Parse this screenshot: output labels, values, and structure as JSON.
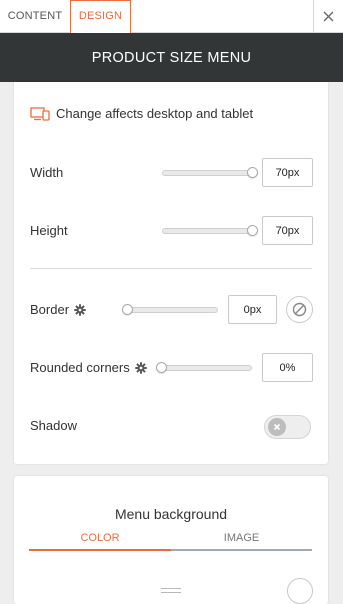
{
  "tabs": {
    "content": "CONTENT",
    "design": "DESIGN"
  },
  "title": "PRODUCT SIZE MENU",
  "device_note": "Change affects desktop and tablet",
  "width": {
    "label": "Width",
    "value": "70px",
    "slider_level": 1.0
  },
  "height": {
    "label": "Height",
    "value": "70px",
    "slider_level": 1.0
  },
  "border": {
    "label": "Border",
    "value": "0px",
    "slider_level": 0
  },
  "rounded": {
    "label": "Rounded corners",
    "value": "0%",
    "slider_level": 0
  },
  "shadow": {
    "label": "Shadow",
    "enabled": false
  },
  "menu_background": {
    "title": "Menu background",
    "tabs": [
      "COLOR",
      "IMAGE"
    ],
    "active_tab": "COLOR"
  },
  "colors": {
    "accent": "#f16a3a",
    "titlebar": "#333637",
    "device_icon": "#f16a3a"
  }
}
